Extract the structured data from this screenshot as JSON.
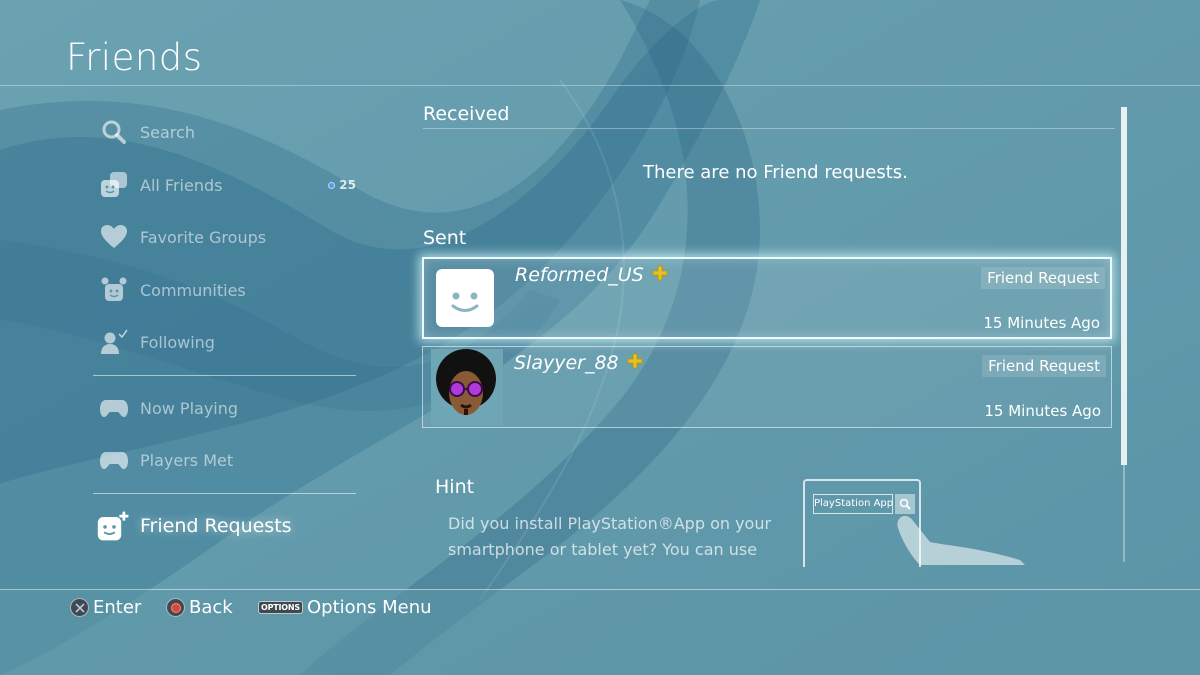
{
  "header": {
    "title": "Friends"
  },
  "sidebar": {
    "items": [
      {
        "label": "Search",
        "icon": "search-icon"
      },
      {
        "label": "All Friends",
        "icon": "friends-icon",
        "count": "25"
      },
      {
        "label": "Favorite Groups",
        "icon": "heart-icon"
      },
      {
        "label": "Communities",
        "icon": "communities-icon"
      },
      {
        "label": "Following",
        "icon": "following-icon"
      },
      {
        "label": "Now Playing",
        "icon": "controller-icon"
      },
      {
        "label": "Players Met",
        "icon": "controller-icon"
      }
    ],
    "selected": {
      "label": "Friend Requests",
      "icon": "friend-request-icon"
    }
  },
  "received": {
    "title": "Received",
    "empty_message": "There are no Friend requests."
  },
  "sent": {
    "title": "Sent",
    "items": [
      {
        "name": "Reformed_US",
        "badge": "playstation-plus-icon",
        "tag": "Friend Request",
        "time": "15 Minutes Ago"
      },
      {
        "name": "Slayyer_88",
        "badge": "playstation-plus-icon",
        "tag": "Friend Request",
        "time": "15 Minutes Ago"
      }
    ]
  },
  "hint": {
    "title": "Hint",
    "text": "Did you install PlayStation®App on your smartphone or tablet yet? You can use",
    "app_search_label": "PlayStation App"
  },
  "footer": {
    "enter": "Enter",
    "back": "Back",
    "options_key": "OPTIONS",
    "options": "Options Menu"
  },
  "colors": {
    "background": "#5f97a8",
    "accent_wave": "#2a6585",
    "plus_gold": "#e8c21a"
  }
}
